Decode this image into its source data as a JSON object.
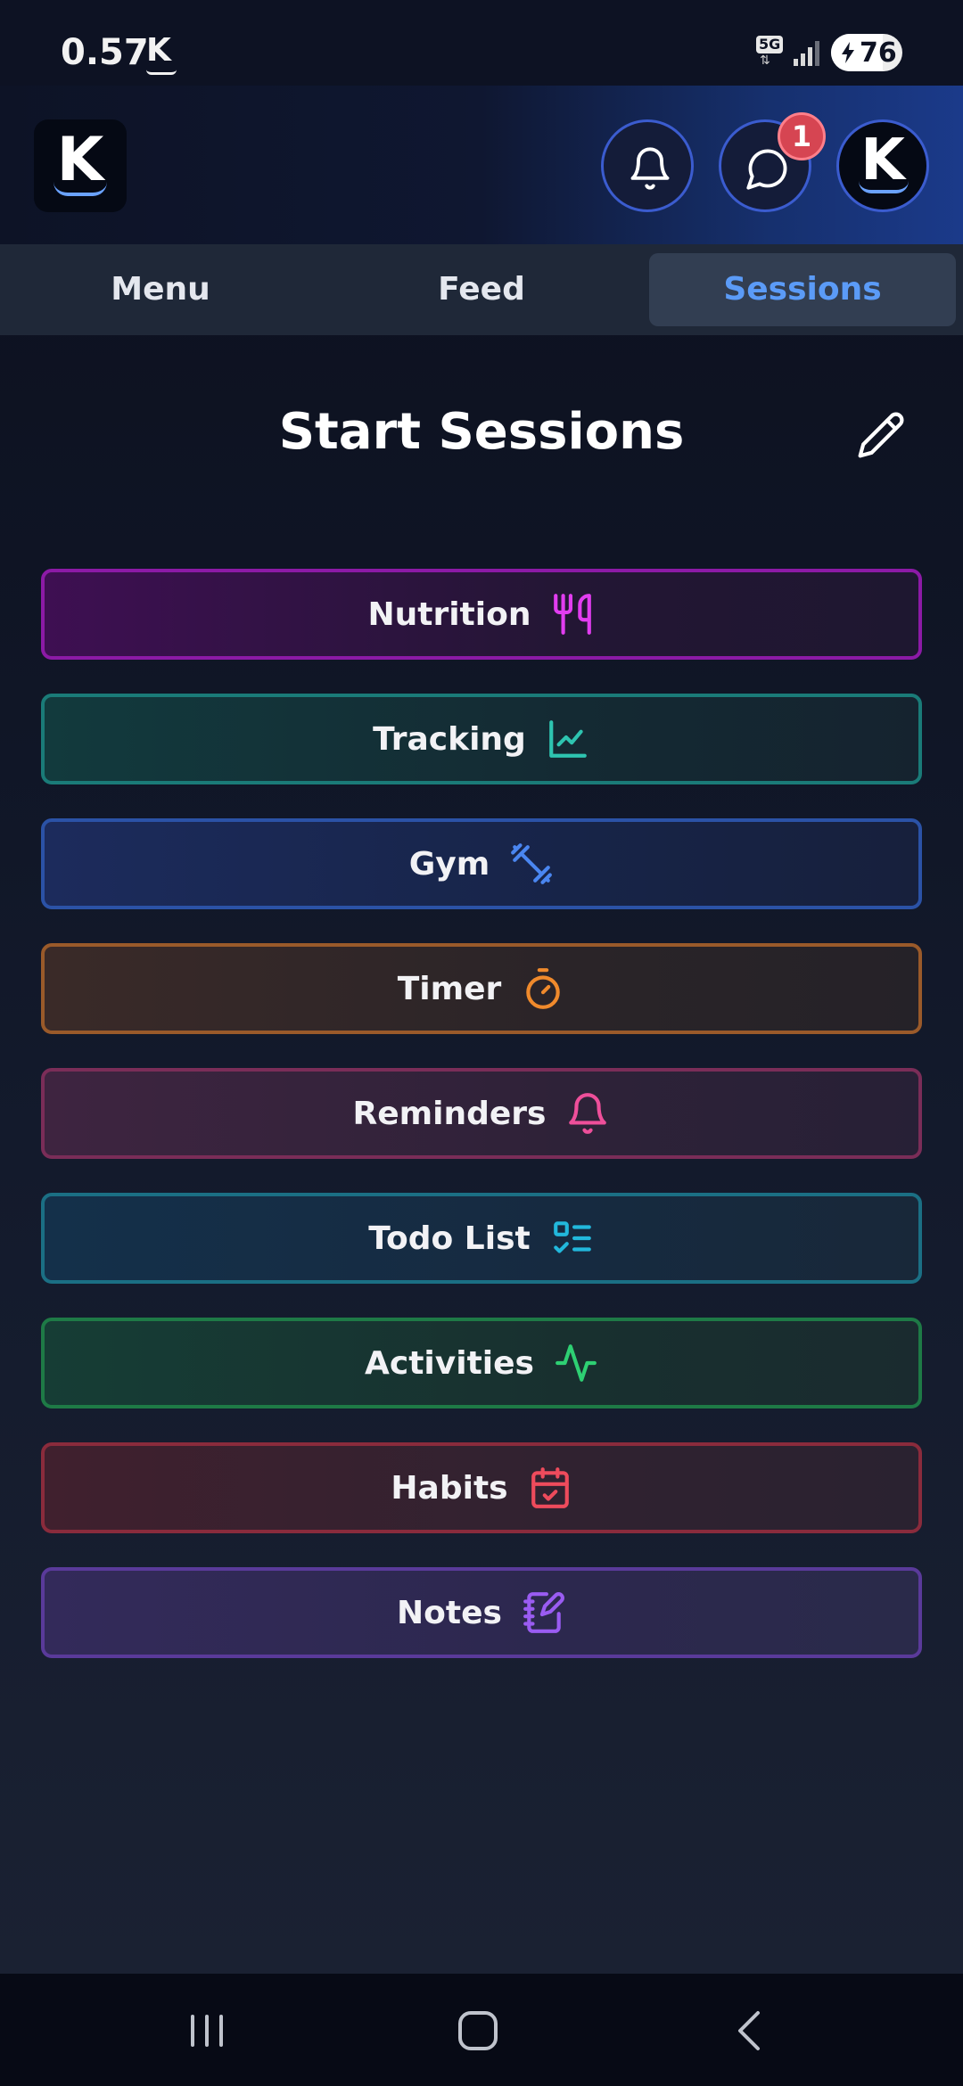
{
  "status_bar": {
    "speed": "0.57",
    "app_indicator": "K",
    "network": "5G",
    "battery": "76"
  },
  "header": {
    "logo_letter": "K",
    "notification_badge": "1",
    "avatar_letter": "K"
  },
  "tabs": [
    {
      "label": "Menu",
      "active": false
    },
    {
      "label": "Feed",
      "active": false
    },
    {
      "label": "Sessions",
      "active": true
    }
  ],
  "page": {
    "title": "Start Sessions"
  },
  "sessions": [
    {
      "label": "Nutrition",
      "icon": "utensils-icon",
      "color": "#e23df0"
    },
    {
      "label": "Tracking",
      "icon": "chart-line-icon",
      "color": "#2ec4b0"
    },
    {
      "label": "Gym",
      "icon": "dumbbell-icon",
      "color": "#4a86f0"
    },
    {
      "label": "Timer",
      "icon": "stopwatch-icon",
      "color": "#f08a2c"
    },
    {
      "label": "Reminders",
      "icon": "bell-icon",
      "color": "#ee4f9a"
    },
    {
      "label": "Todo List",
      "icon": "checklist-icon",
      "color": "#22b8dc"
    },
    {
      "label": "Activities",
      "icon": "activity-icon",
      "color": "#2ed073"
    },
    {
      "label": "Habits",
      "icon": "calendar-check-icon",
      "color": "#ee4b5c"
    },
    {
      "label": "Notes",
      "icon": "notebook-pen-icon",
      "color": "#9a5cf2"
    }
  ]
}
